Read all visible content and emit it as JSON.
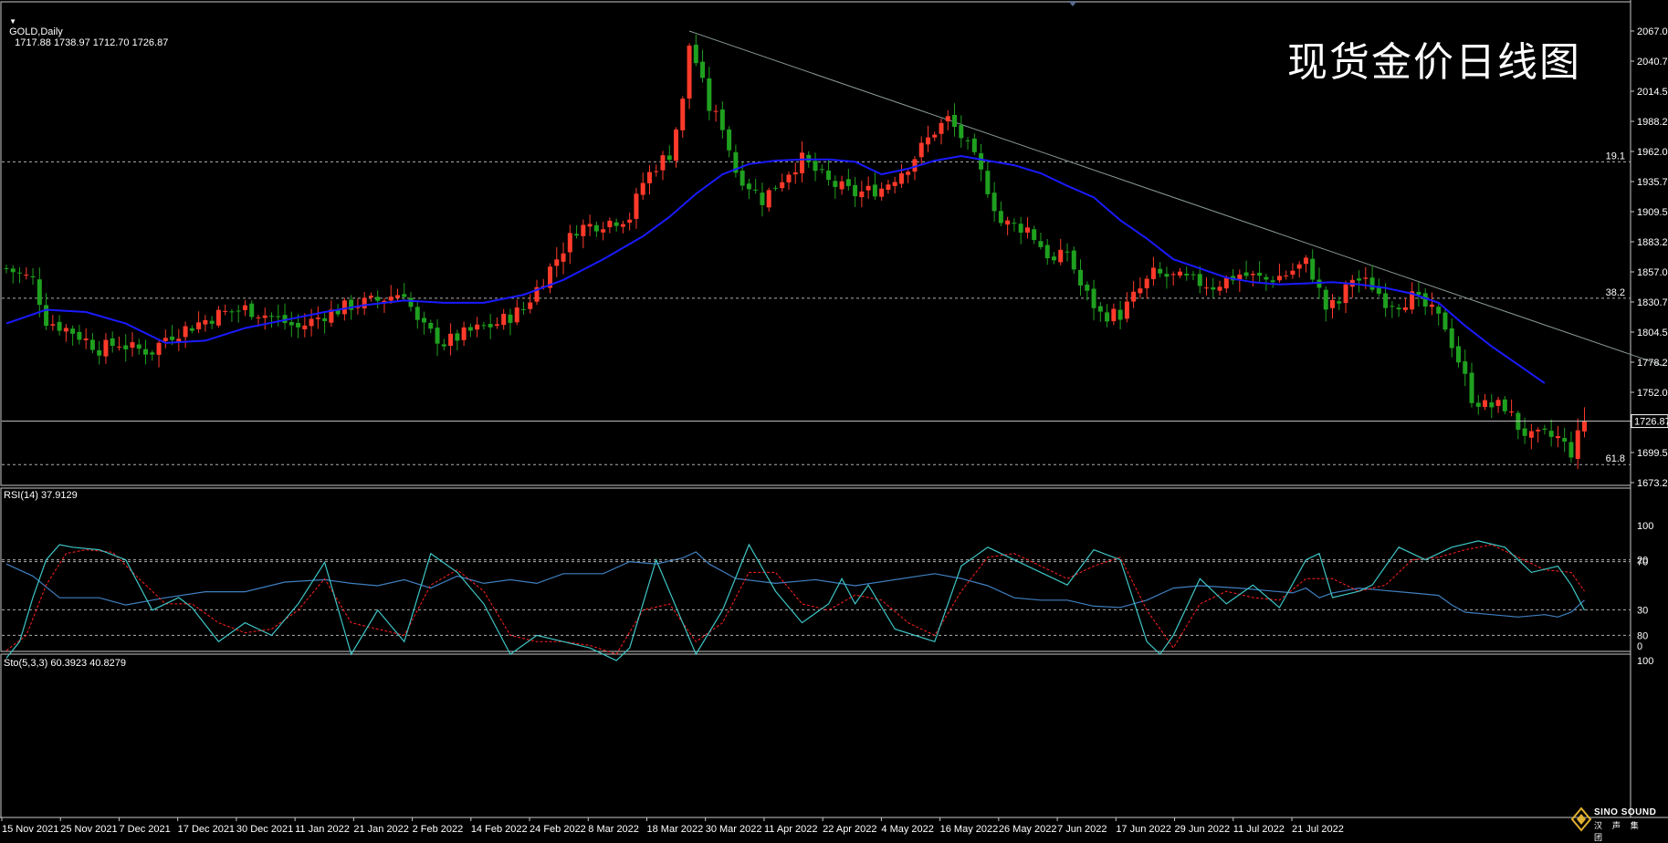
{
  "symbol_header": {
    "dropdown_icon": "triangle-down-icon",
    "symbol": "GOLD,Daily",
    "ohlc": "1717.88 1738.97 1712.70 1726.87"
  },
  "caption": "现货金价日线图",
  "logo": {
    "name": "SINO SOUND",
    "sub": "汉 声 集 团",
    "icon": "diamond-logo-icon"
  },
  "colors": {
    "background": "#000000",
    "grid": "#c0c0c0",
    "bull_candle": "#ff3a2a",
    "bear_candle": "#1fa01f",
    "moving_average": "#1a1aff",
    "rsi_line": "#3f7fbf",
    "stoch_main": "#3fc5c5",
    "stoch_signal": "#ff2020",
    "fib_label": "#9a8cff",
    "trendline": "#8a9a9a"
  },
  "price_axis": {
    "ticks": [
      "2067.00",
      "2040.75",
      "2014.50",
      "1988.25",
      "1962.00",
      "1935.75",
      "1909.50",
      "1883.25",
      "1857.00",
      "1830.75",
      "1804.50",
      "1778.25",
      "1752.00",
      "1699.50",
      "1673.25"
    ],
    "current_price": "1726.87"
  },
  "fib_levels": [
    {
      "label": "19.1",
      "price": 1953
    },
    {
      "label": "38.2",
      "price": 1834
    },
    {
      "label": "61.8",
      "price": 1689
    }
  ],
  "rsi_panel": {
    "title": "RSI(14) 37.9129",
    "ticks": [
      "100",
      "70",
      "30",
      "0"
    ]
  },
  "stoch_panel": {
    "title": "Sto(5,3,3) 60.3923 40.8279",
    "ticks": [
      "100",
      "80",
      "20"
    ]
  },
  "date_axis": [
    "15 Nov 2021",
    "25 Nov 2021",
    "7 Dec 2021",
    "17 Dec 2021",
    "30 Dec 2021",
    "11 Jan 2022",
    "21 Jan 2022",
    "2 Feb 2022",
    "14 Feb 2022",
    "24 Feb 2022",
    "8 Mar 2022",
    "18 Mar 2022",
    "30 Mar 2022",
    "11 Apr 2022",
    "22 Apr 2022",
    "4 May 2022",
    "16 May 2022",
    "26 May 2022",
    "7 Jun 2022",
    "17 Jun 2022",
    "29 Jun 2022",
    "11 Jul 2022",
    "21 Jul 2022"
  ],
  "chart_data": {
    "type": "candlestick",
    "y_range": [
      1673.25,
      2080
    ],
    "anchors": [
      [
        0,
        1860
      ],
      [
        4,
        1850
      ],
      [
        6,
        1815
      ],
      [
        10,
        1805
      ],
      [
        14,
        1790
      ],
      [
        17,
        1795
      ],
      [
        19,
        1790
      ],
      [
        22,
        1788
      ],
      [
        24,
        1800
      ],
      [
        28,
        1810
      ],
      [
        32,
        1820
      ],
      [
        36,
        1825
      ],
      [
        40,
        1818
      ],
      [
        44,
        1808
      ],
      [
        48,
        1820
      ],
      [
        52,
        1828
      ],
      [
        56,
        1832
      ],
      [
        60,
        1840
      ],
      [
        62,
        1812
      ],
      [
        66,
        1795
      ],
      [
        70,
        1805
      ],
      [
        74,
        1812
      ],
      [
        78,
        1825
      ],
      [
        82,
        1860
      ],
      [
        86,
        1895
      ],
      [
        90,
        1900
      ],
      [
        94,
        1905
      ],
      [
        96,
        1935
      ],
      [
        98,
        1950
      ],
      [
        100,
        1960
      ],
      [
        102,
        2005
      ],
      [
        103,
        2055
      ],
      [
        104,
        2040
      ],
      [
        106,
        2000
      ],
      [
        108,
        1985
      ],
      [
        110,
        1945
      ],
      [
        114,
        1920
      ],
      [
        118,
        1945
      ],
      [
        120,
        1955
      ],
      [
        124,
        1935
      ],
      [
        128,
        1925
      ],
      [
        132,
        1930
      ],
      [
        136,
        1950
      ],
      [
        140,
        1980
      ],
      [
        142,
        1990
      ],
      [
        144,
        1975
      ],
      [
        146,
        1955
      ],
      [
        148,
        1930
      ],
      [
        150,
        1900
      ],
      [
        154,
        1895
      ],
      [
        156,
        1880
      ],
      [
        158,
        1865
      ],
      [
        160,
        1875
      ],
      [
        162,
        1845
      ],
      [
        165,
        1820
      ],
      [
        168,
        1820
      ],
      [
        170,
        1835
      ],
      [
        173,
        1855
      ],
      [
        178,
        1850
      ],
      [
        182,
        1845
      ],
      [
        186,
        1855
      ],
      [
        190,
        1850
      ],
      [
        193,
        1855
      ],
      [
        196,
        1865
      ],
      [
        197,
        1855
      ],
      [
        199,
        1825
      ],
      [
        201,
        1830
      ],
      [
        203,
        1852
      ],
      [
        206,
        1845
      ],
      [
        208,
        1832
      ],
      [
        210,
        1830
      ],
      [
        212,
        1835
      ],
      [
        215,
        1822
      ],
      [
        217,
        1810
      ],
      [
        219,
        1780
      ],
      [
        221,
        1748
      ],
      [
        223,
        1740
      ],
      [
        226,
        1740
      ],
      [
        228,
        1722
      ],
      [
        230,
        1712
      ],
      [
        232,
        1714
      ],
      [
        234,
        1712
      ],
      [
        236,
        1700
      ],
      [
        238,
        1727
      ]
    ],
    "moving_average": [
      [
        0,
        1812
      ],
      [
        6,
        1824
      ],
      [
        12,
        1822
      ],
      [
        18,
        1812
      ],
      [
        24,
        1795
      ],
      [
        30,
        1797
      ],
      [
        36,
        1808
      ],
      [
        42,
        1815
      ],
      [
        48,
        1822
      ],
      [
        54,
        1828
      ],
      [
        60,
        1832
      ],
      [
        66,
        1830
      ],
      [
        72,
        1830
      ],
      [
        78,
        1837
      ],
      [
        84,
        1850
      ],
      [
        90,
        1868
      ],
      [
        96,
        1888
      ],
      [
        100,
        1905
      ],
      [
        104,
        1925
      ],
      [
        108,
        1942
      ],
      [
        112,
        1951
      ],
      [
        116,
        1954
      ],
      [
        120,
        1955
      ],
      [
        124,
        1955
      ],
      [
        128,
        1953
      ],
      [
        132,
        1942
      ],
      [
        136,
        1947
      ],
      [
        140,
        1954
      ],
      [
        144,
        1958
      ],
      [
        148,
        1954
      ],
      [
        152,
        1950
      ],
      [
        156,
        1943
      ],
      [
        160,
        1932
      ],
      [
        164,
        1922
      ],
      [
        168,
        1902
      ],
      [
        172,
        1886
      ],
      [
        176,
        1868
      ],
      [
        180,
        1860
      ],
      [
        184,
        1852
      ],
      [
        188,
        1848
      ],
      [
        192,
        1846
      ],
      [
        196,
        1847
      ],
      [
        200,
        1848
      ],
      [
        204,
        1846
      ],
      [
        208,
        1843
      ],
      [
        212,
        1838
      ],
      [
        216,
        1830
      ],
      [
        220,
        1810
      ],
      [
        224,
        1792
      ],
      [
        228,
        1776
      ],
      [
        232,
        1760
      ]
    ],
    "trendline": [
      [
        103,
        2067
      ],
      [
        250,
        1775
      ]
    ],
    "rsi": [
      [
        0,
        68
      ],
      [
        4,
        58
      ],
      [
        8,
        40
      ],
      [
        14,
        40
      ],
      [
        18,
        34
      ],
      [
        24,
        40
      ],
      [
        30,
        45
      ],
      [
        36,
        45
      ],
      [
        42,
        53
      ],
      [
        48,
        55
      ],
      [
        52,
        52
      ],
      [
        56,
        50
      ],
      [
        60,
        55
      ],
      [
        64,
        48
      ],
      [
        68,
        58
      ],
      [
        72,
        52
      ],
      [
        76,
        55
      ],
      [
        80,
        52
      ],
      [
        84,
        60
      ],
      [
        90,
        60
      ],
      [
        94,
        70
      ],
      [
        98,
        68
      ],
      [
        102,
        73
      ],
      [
        104,
        78
      ],
      [
        106,
        68
      ],
      [
        110,
        56
      ],
      [
        116,
        52
      ],
      [
        122,
        55
      ],
      [
        128,
        50
      ],
      [
        134,
        55
      ],
      [
        140,
        60
      ],
      [
        144,
        56
      ],
      [
        148,
        50
      ],
      [
        152,
        40
      ],
      [
        156,
        38
      ],
      [
        160,
        38
      ],
      [
        164,
        33
      ],
      [
        168,
        32
      ],
      [
        172,
        38
      ],
      [
        176,
        48
      ],
      [
        180,
        50
      ],
      [
        186,
        48
      ],
      [
        190,
        46
      ],
      [
        194,
        44
      ],
      [
        196,
        48
      ],
      [
        198,
        40
      ],
      [
        200,
        44
      ],
      [
        204,
        48
      ],
      [
        208,
        46
      ],
      [
        212,
        44
      ],
      [
        216,
        42
      ],
      [
        218,
        34
      ],
      [
        220,
        28
      ],
      [
        224,
        26
      ],
      [
        228,
        24
      ],
      [
        232,
        26
      ],
      [
        234,
        24
      ],
      [
        236,
        28
      ],
      [
        238,
        38
      ]
    ],
    "stoch_main": [
      [
        0,
        98
      ],
      [
        2,
        85
      ],
      [
        4,
        50
      ],
      [
        6,
        20
      ],
      [
        8,
        8
      ],
      [
        10,
        10
      ],
      [
        14,
        12
      ],
      [
        18,
        20
      ],
      [
        22,
        60
      ],
      [
        26,
        50
      ],
      [
        28,
        58
      ],
      [
        32,
        85
      ],
      [
        36,
        70
      ],
      [
        40,
        80
      ],
      [
        44,
        55
      ],
      [
        48,
        22
      ],
      [
        52,
        95
      ],
      [
        56,
        60
      ],
      [
        60,
        85
      ],
      [
        64,
        15
      ],
      [
        68,
        30
      ],
      [
        72,
        55
      ],
      [
        76,
        95
      ],
      [
        80,
        80
      ],
      [
        84,
        85
      ],
      [
        88,
        90
      ],
      [
        92,
        100
      ],
      [
        94,
        90
      ],
      [
        98,
        20
      ],
      [
        104,
        95
      ],
      [
        108,
        60
      ],
      [
        112,
        8
      ],
      [
        116,
        45
      ],
      [
        120,
        70
      ],
      [
        124,
        55
      ],
      [
        126,
        35
      ],
      [
        128,
        55
      ],
      [
        130,
        40
      ],
      [
        134,
        75
      ],
      [
        140,
        85
      ],
      [
        144,
        25
      ],
      [
        148,
        10
      ],
      [
        152,
        20
      ],
      [
        156,
        30
      ],
      [
        160,
        40
      ],
      [
        164,
        12
      ],
      [
        168,
        20
      ],
      [
        172,
        85
      ],
      [
        174,
        95
      ],
      [
        176,
        80
      ],
      [
        180,
        35
      ],
      [
        184,
        55
      ],
      [
        188,
        40
      ],
      [
        192,
        58
      ],
      [
        196,
        20
      ],
      [
        198,
        15
      ],
      [
        200,
        50
      ],
      [
        204,
        45
      ],
      [
        206,
        40
      ],
      [
        210,
        10
      ],
      [
        214,
        20
      ],
      [
        218,
        10
      ],
      [
        222,
        5
      ],
      [
        226,
        10
      ],
      [
        230,
        30
      ],
      [
        234,
        25
      ],
      [
        236,
        40
      ],
      [
        238,
        60
      ]
    ],
    "stoch_signal": [
      [
        0,
        92
      ],
      [
        3,
        80
      ],
      [
        6,
        40
      ],
      [
        9,
        15
      ],
      [
        12,
        12
      ],
      [
        16,
        14
      ],
      [
        20,
        35
      ],
      [
        24,
        55
      ],
      [
        28,
        55
      ],
      [
        32,
        70
      ],
      [
        36,
        78
      ],
      [
        40,
        75
      ],
      [
        44,
        60
      ],
      [
        48,
        35
      ],
      [
        52,
        70
      ],
      [
        56,
        75
      ],
      [
        60,
        80
      ],
      [
        64,
        40
      ],
      [
        68,
        28
      ],
      [
        72,
        45
      ],
      [
        76,
        80
      ],
      [
        80,
        85
      ],
      [
        84,
        85
      ],
      [
        88,
        88
      ],
      [
        92,
        95
      ],
      [
        96,
        60
      ],
      [
        100,
        55
      ],
      [
        104,
        85
      ],
      [
        108,
        70
      ],
      [
        112,
        30
      ],
      [
        116,
        30
      ],
      [
        120,
        55
      ],
      [
        124,
        60
      ],
      [
        128,
        48
      ],
      [
        132,
        52
      ],
      [
        136,
        70
      ],
      [
        140,
        80
      ],
      [
        144,
        45
      ],
      [
        148,
        18
      ],
      [
        152,
        15
      ],
      [
        156,
        25
      ],
      [
        160,
        35
      ],
      [
        164,
        25
      ],
      [
        168,
        18
      ],
      [
        172,
        60
      ],
      [
        176,
        90
      ],
      [
        180,
        55
      ],
      [
        184,
        45
      ],
      [
        188,
        50
      ],
      [
        192,
        52
      ],
      [
        196,
        35
      ],
      [
        200,
        35
      ],
      [
        204,
        45
      ],
      [
        208,
        40
      ],
      [
        212,
        20
      ],
      [
        216,
        18
      ],
      [
        220,
        12
      ],
      [
        224,
        8
      ],
      [
        228,
        18
      ],
      [
        232,
        28
      ],
      [
        236,
        30
      ],
      [
        238,
        45
      ]
    ]
  }
}
